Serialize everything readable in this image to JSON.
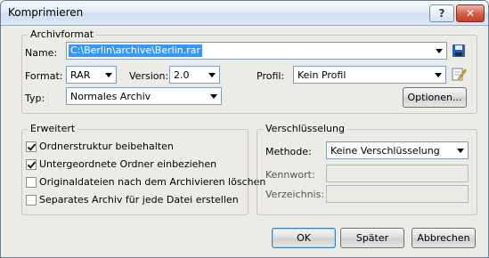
{
  "window": {
    "title": "Komprimieren"
  },
  "titlebar": {
    "help_glyph": "?",
    "close_glyph": "✕"
  },
  "archive": {
    "group_title": "Archivformat",
    "name_label": "Name:",
    "name_value": "C:\\Berlin\\archive\\Berlin.rar",
    "format_label": "Format:",
    "format_value": "RAR",
    "version_label": "Version:",
    "version_value": "2.0",
    "profile_label": "Profil:",
    "profile_value": "Kein Profil",
    "type_label": "Typ:",
    "type_value": "Normales Archiv",
    "options_button": "Optionen...",
    "icons": {
      "save": "floppy-disk-icon",
      "edit_profile": "edit-profile-icon"
    }
  },
  "advanced": {
    "group_title": "Erweitert",
    "options": [
      {
        "label": "Ordnerstruktur beibehalten",
        "checked": true
      },
      {
        "label": "Untergeordnete Ordner einbeziehen",
        "checked": true
      },
      {
        "label": "Originaldateien nach dem Archivieren löschen",
        "checked": false
      },
      {
        "label": "Separates Archiv für jede Datei erstellen",
        "checked": false
      }
    ]
  },
  "encryption": {
    "group_title": "Verschlüsselung",
    "method_label": "Methode:",
    "method_value": "Keine Verschlüsselung",
    "password_label": "Kennwort:",
    "password_value": "",
    "directory_label": "Verzeichnis:",
    "directory_value": ""
  },
  "footer": {
    "ok_button": "OK",
    "later_button": "Später",
    "cancel_button": "Abbrechen"
  },
  "colors": {
    "selection": "#3399ff",
    "close_button": "#c2412a",
    "dialog_bg": "#ecebe6"
  }
}
